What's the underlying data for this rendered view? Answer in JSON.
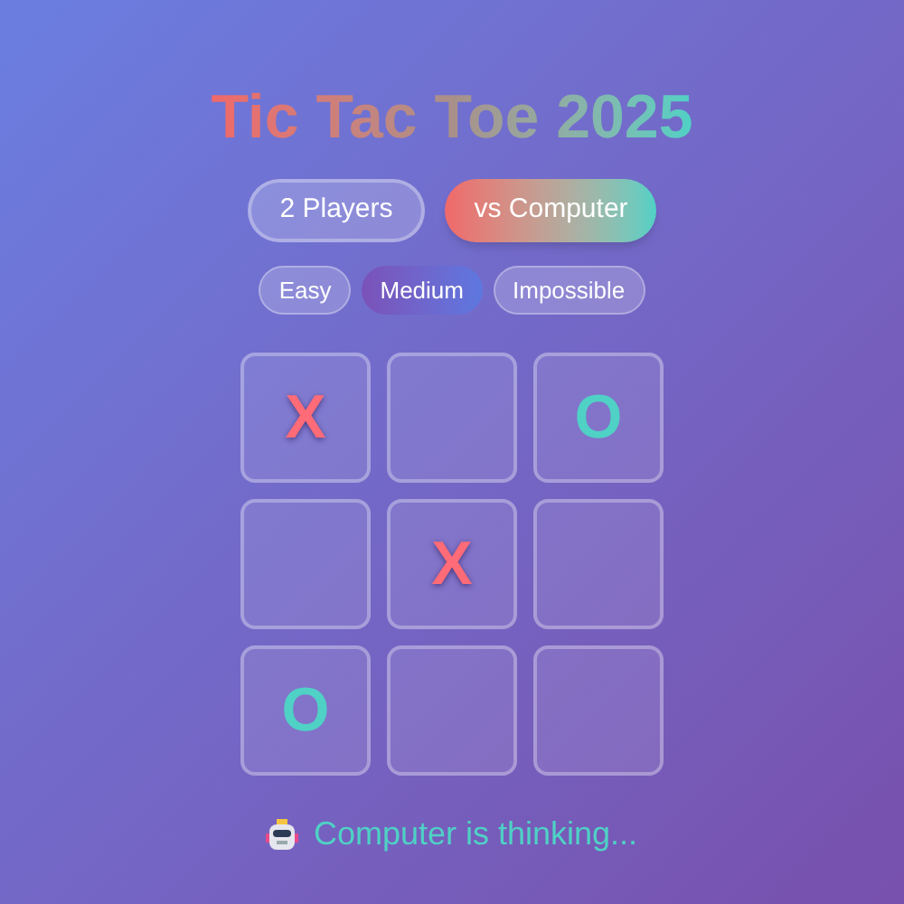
{
  "title": "Tic Tac Toe 2025",
  "modes": [
    {
      "label": "2 Players",
      "selected": false
    },
    {
      "label": "vs Computer",
      "selected": true
    }
  ],
  "difficulties": [
    {
      "label": "Easy",
      "selected": false
    },
    {
      "label": "Medium",
      "selected": true
    },
    {
      "label": "Impossible",
      "selected": false
    }
  ],
  "board": [
    {
      "kind": "x",
      "text": "X"
    },
    {
      "kind": "empty"
    },
    {
      "kind": "o",
      "text": "O"
    },
    {
      "kind": "empty"
    },
    {
      "kind": "x",
      "text": "X"
    },
    {
      "kind": "empty"
    },
    {
      "kind": "o",
      "text": "O"
    },
    {
      "kind": "empty"
    },
    {
      "kind": "empty"
    }
  ],
  "status": "Computer is thinking..."
}
